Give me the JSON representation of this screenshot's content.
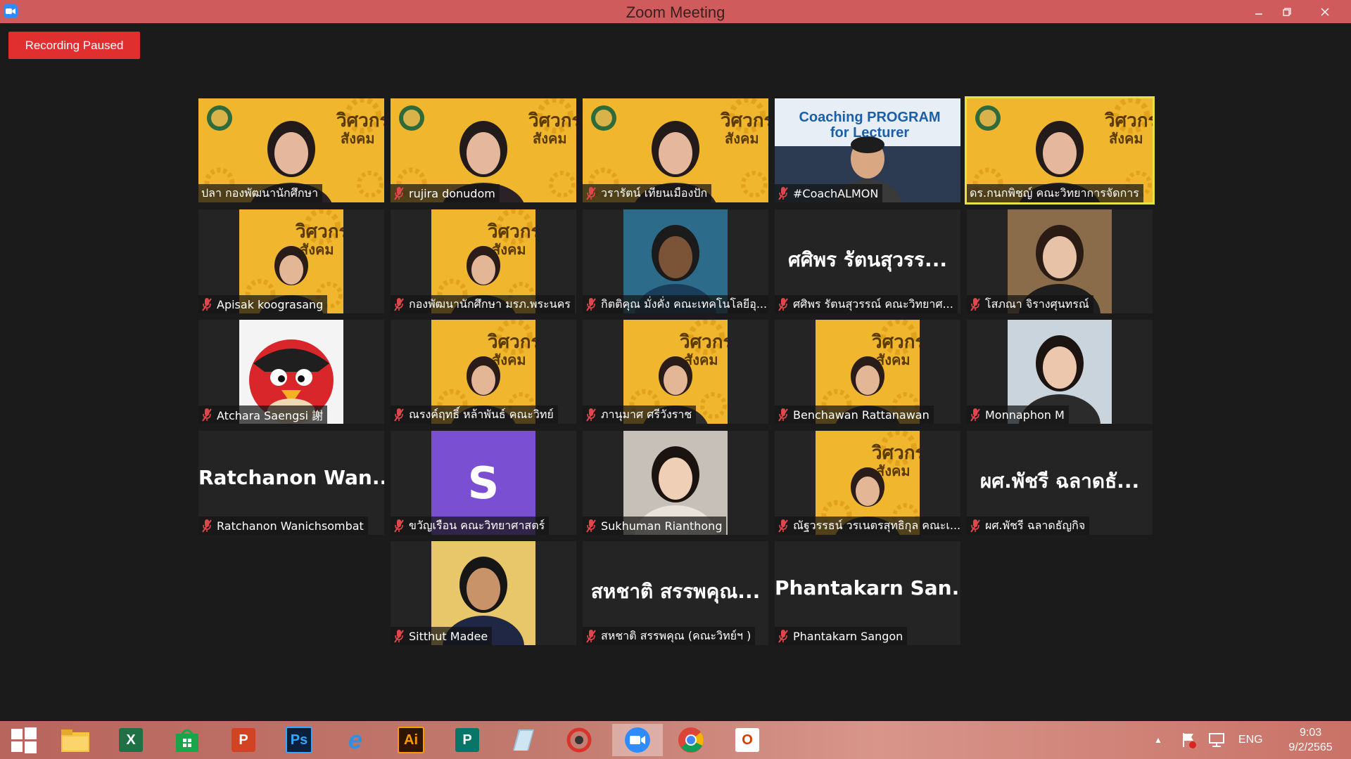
{
  "window": {
    "title": "Zoom Meeting"
  },
  "recording": {
    "status": "Recording Paused"
  },
  "banner_text": {
    "line1": "วิศวกร",
    "line2": "สังคม"
  },
  "banner_logo_text": "Coaching PROGRAM for Lecturer",
  "participants": [
    {
      "name": "ปลา กองพัฒนานักศึกษา",
      "muted": false
    },
    {
      "name": "rujira donudom",
      "muted": true
    },
    {
      "name": "วรารัตน์ เทียนเมืองปัก",
      "muted": true
    },
    {
      "name": "#CoachALMON",
      "muted": true,
      "overlay": "Coaching PROGRAM for Lecturer"
    },
    {
      "name": "ดร.กนกพิชญ์ คณะวิทยาการจัดการ",
      "muted": false,
      "active_speaker": true
    },
    {
      "name": "Apisak koograsang",
      "muted": true
    },
    {
      "name": "กองพัฒนานักศึกษา มรภ.พระนคร",
      "muted": true
    },
    {
      "name": "กิตติคุณ มั่งคั่ง คณะเทคโนโลยีอุ...",
      "muted": true
    },
    {
      "name": "ศศิพร รัตนสุวรรณ์ คณะวิทยาศ...",
      "muted": true,
      "display_text": "ศศิพร รัตนสุวรร..."
    },
    {
      "name": "โสภณา จิรางศุนทรณ์",
      "muted": true
    },
    {
      "name": "Atchara Saengsi 謝",
      "muted": true
    },
    {
      "name": "ณรงค์ฤทธิ์ หล้าพันธ์ คณะวิทย์",
      "muted": true
    },
    {
      "name": "ภานุมาศ ศรีวังราช",
      "muted": true
    },
    {
      "name": "Benchawan Rattanawan",
      "muted": true
    },
    {
      "name": "Monnaphon M",
      "muted": true
    },
    {
      "name": "Ratchanon Wanichsombat",
      "muted": true,
      "display_text": "Ratchanon Wan..."
    },
    {
      "name": "ขวัญเรือน คณะวิทยาศาสตร์",
      "muted": true,
      "avatar_letter": "S",
      "avatar_color": "#7b4fd1"
    },
    {
      "name": "Sukhuman Rianthong",
      "muted": true
    },
    {
      "name": "ณัฐวรรธน์ วรเนตรสุทธิกุล คณะเ...",
      "muted": true
    },
    {
      "name": "ผศ.พัชรี ฉลาดธัญกิจ",
      "muted": true,
      "display_text": "ผศ.พัชรี ฉลาดธั..."
    },
    {
      "name": "Sitthut Madee",
      "muted": true
    },
    {
      "name": "สหชาติ สรรพคุณ (คณะวิทย์ฯ )",
      "muted": true,
      "display_text": "สหชาติ สรรพคุณ..."
    },
    {
      "name": "Phantakarn Sangon",
      "muted": true,
      "display_text": "Phantakarn San..."
    }
  ],
  "taskbar": {
    "apps": [
      {
        "name": "file-explorer"
      },
      {
        "name": "excel",
        "glyph": "X"
      },
      {
        "name": "store"
      },
      {
        "name": "powerpoint",
        "glyph": "P"
      },
      {
        "name": "photoshop",
        "glyph": "Ps"
      },
      {
        "name": "internet-explorer",
        "glyph": "e"
      },
      {
        "name": "illustrator",
        "glyph": "Ai"
      },
      {
        "name": "publisher",
        "glyph": "P"
      },
      {
        "name": "notepad"
      },
      {
        "name": "photoscape"
      },
      {
        "name": "zoom",
        "active": true
      },
      {
        "name": "chrome"
      },
      {
        "name": "office",
        "glyph": "O"
      }
    ],
    "language": "ENG",
    "time": "9:03",
    "date": "9/2/2565"
  },
  "colors": {
    "titlebar": "#cf5b5d",
    "active_speaker": "#e6e340",
    "record_badge": "#e02f2f",
    "muted_mic": "#e0464b"
  }
}
